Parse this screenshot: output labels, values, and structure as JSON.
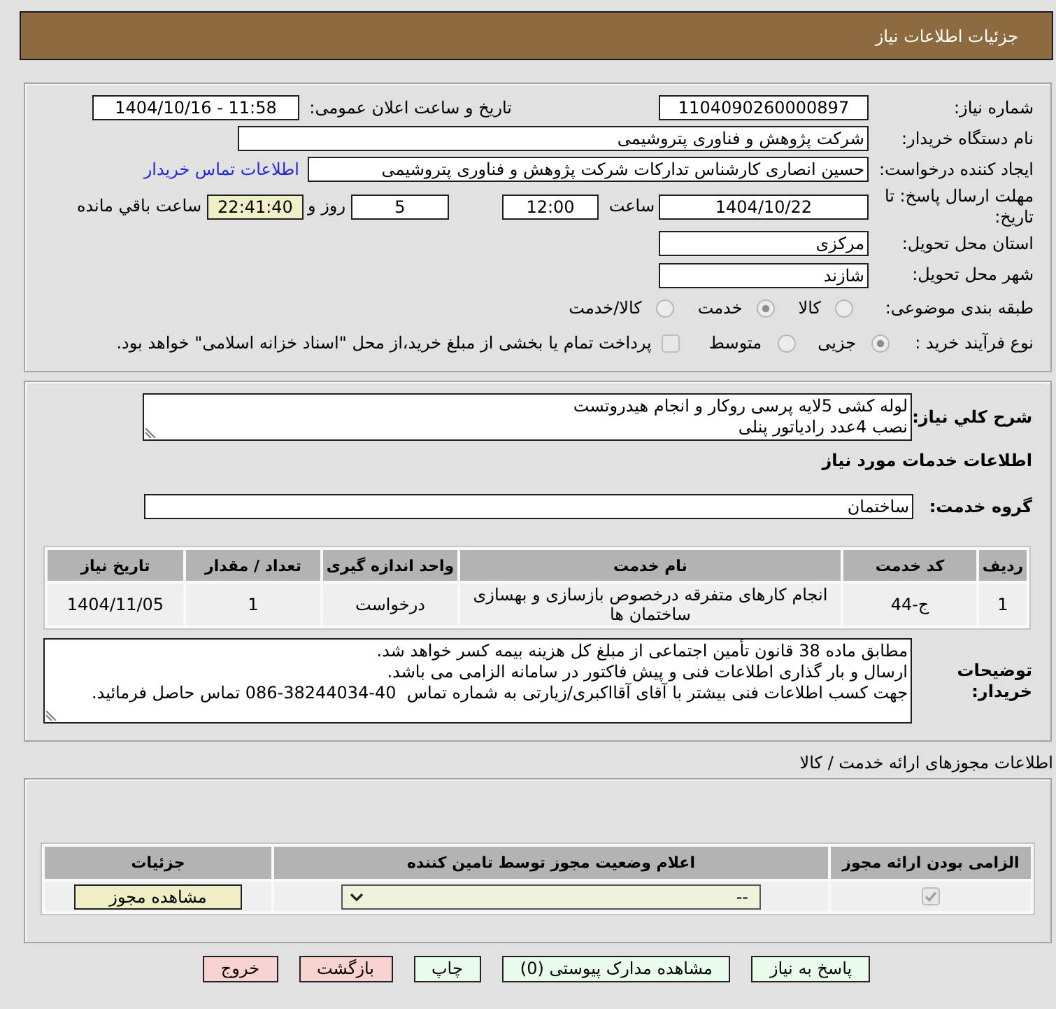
{
  "header": {
    "title": "جزئیات اطلاعات نیاز"
  },
  "need_details": {
    "need_number": {
      "label": "شماره نیاز:",
      "value": "1104090260000897"
    },
    "announcement": {
      "label": "تاریخ و ساعت اعلان عمومی:",
      "value": "1404/10/16 - 11:58"
    },
    "buyer_org": {
      "label": "نام دستگاه خریدار:",
      "value": "شرکت پژوهش و فناوری پتروشیمی"
    },
    "requester": {
      "label": "ایجاد کننده درخواست:",
      "value": "حسین انصاری کارشناس تدارکات شرکت پژوهش و فناوری پتروشیمی",
      "contact_link": "اطلاعات تماس خریدار"
    },
    "deadline": {
      "label": "مهلت ارسال پاسخ: تا تاریخ:",
      "date": "1404/10/22",
      "time_label": "ساعت",
      "time": "12:00",
      "days": "5",
      "days_label": "روز و",
      "remaining": "22:41:40",
      "remaining_label": "ساعت باقي مانده"
    },
    "province": {
      "label": "استان محل تحویل:",
      "value": "مرکزی"
    },
    "city": {
      "label": "شهر محل تحویل:",
      "value": "شازند"
    },
    "category": {
      "label": "طبقه بندی موضوعی:",
      "options": [
        {
          "label": "کالا",
          "selected": false
        },
        {
          "label": "خدمت",
          "selected": true
        },
        {
          "label": "کالا/خدمت",
          "selected": false
        }
      ]
    },
    "purchase_type": {
      "label": "نوع فرآیند خرید :",
      "options": [
        {
          "label": "جزیی",
          "selected": true
        },
        {
          "label": "متوسط",
          "selected": false
        }
      ],
      "treasury": {
        "label": "پرداخت تمام یا بخشی از مبلغ خرید،از محل \"اسناد خزانه اسلامی\" خواهد بود.",
        "checked": false
      }
    }
  },
  "requirements": {
    "description": {
      "label": "شرح کلي نیاز:",
      "lines": [
        "لوله کشی 5لایه پرسی روکار و انجام هیدروتست",
        "نصب 4عدد رادیاتور پنلی"
      ]
    },
    "services_title": "اطلاعات خدمات مورد نیاز",
    "service_group": {
      "label": "گروه خدمت:",
      "value": "ساختمان"
    },
    "services_table": {
      "columns": [
        "ردیف",
        "کد خدمت",
        "نام خدمت",
        "واحد اندازه گیری",
        "تعداد / مقدار",
        "تاریخ نیاز"
      ],
      "rows": [
        [
          "1",
          "ج-44",
          "انجام کارهای متفرقه درخصوص بازسازی و بهسازی ساختمان ها",
          "درخواست",
          "1",
          "1404/11/05"
        ]
      ]
    },
    "buyer_notes": {
      "label": "توضیحات خریدار:",
      "lines": [
        "مطابق ماده 38 قانون تأمین اجتماعی از مبلغ کل هزینه بیمه کسر خواهد شد.",
        "ارسال و بار گذاری اطلاعات فنی و پیش فاکتور در سامانه الزامی می باشد.",
        "جهت کسب اطلاعات فنی بیشتر با آقای آقااکبری/زیارتی به شماره تماس  086-38244034-40 تماس حاصل فرمائید."
      ]
    }
  },
  "licenses": {
    "title": "اطلاعات مجوزهای ارائه خدمت / کالا",
    "columns": [
      "الزامی بودن ارائه مجوز",
      "اعلام وضعیت مجوز توسط تامین کننده",
      "جزئیات"
    ],
    "rows": [
      {
        "required": true,
        "status": "--",
        "details_button": "مشاهده مجوز"
      }
    ]
  },
  "actions": [
    {
      "label": "پاسخ به نیاز",
      "kind": "primary"
    },
    {
      "label": "مشاهده مدارک پیوستی (0)",
      "kind": "primary"
    },
    {
      "label": "چاپ",
      "kind": "primary"
    },
    {
      "label": "بازگشت",
      "kind": "exit"
    },
    {
      "label": "خروج",
      "kind": "exit"
    }
  ]
}
